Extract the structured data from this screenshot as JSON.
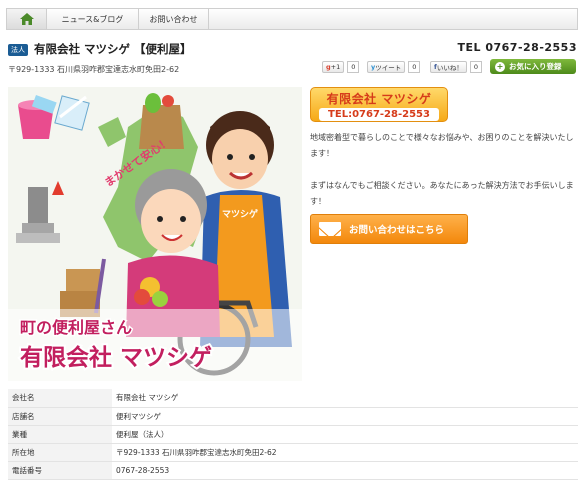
{
  "nav": {
    "home_icon": "home-icon",
    "items": [
      "ニュース&ブログ",
      "お問い合わせ"
    ]
  },
  "header": {
    "badge": "法人",
    "title": "有限会社 マツシゲ 【便利屋】",
    "tel": "TEL 0767-28-2553",
    "address": "〒929-1333 石川県羽咋郡宝達志水町免田2-62"
  },
  "social": {
    "gplus_label": "+1",
    "gplus_count": "0",
    "tweet_label": "ツイート",
    "tweet_count": "0",
    "like_label": "いいね！",
    "like_count": "0",
    "favorite_label": "お気に入り登録"
  },
  "hero": {
    "bubble_text": "まかせて安心！",
    "apron_text": "マツシゲ",
    "caption_line1": "町の便利屋さん",
    "caption_line2": "有限会社 マツシゲ"
  },
  "logo": {
    "name": "有限会社 マツシゲ",
    "tel": "TEL:0767-28-2553"
  },
  "description": {
    "p1": "地域密着型で暮らしのことで様々なお悩みや、お困りのことを解決いたします！",
    "p2": "まずはなんでもご相談ください。あなたにあった解決方法でお手伝いします！"
  },
  "contact_button": "お問い合わせはこちら",
  "info": [
    {
      "key": "会社名",
      "value": "有限会社 マツシゲ"
    },
    {
      "key": "店舗名",
      "value": "便利マツシゲ"
    },
    {
      "key": "業種",
      "value": "便利屋（法人）"
    },
    {
      "key": "所在地",
      "value": "〒929-1333 石川県羽咋郡宝達志水町免田2-62"
    },
    {
      "key": "電話番号",
      "value": "0767-28-2553"
    }
  ],
  "colors": {
    "accent_orange": "#f3880c",
    "badge_blue": "#1b5c94",
    "favorite_green": "#4d8a1a",
    "logo_red": "#d63b1a"
  }
}
